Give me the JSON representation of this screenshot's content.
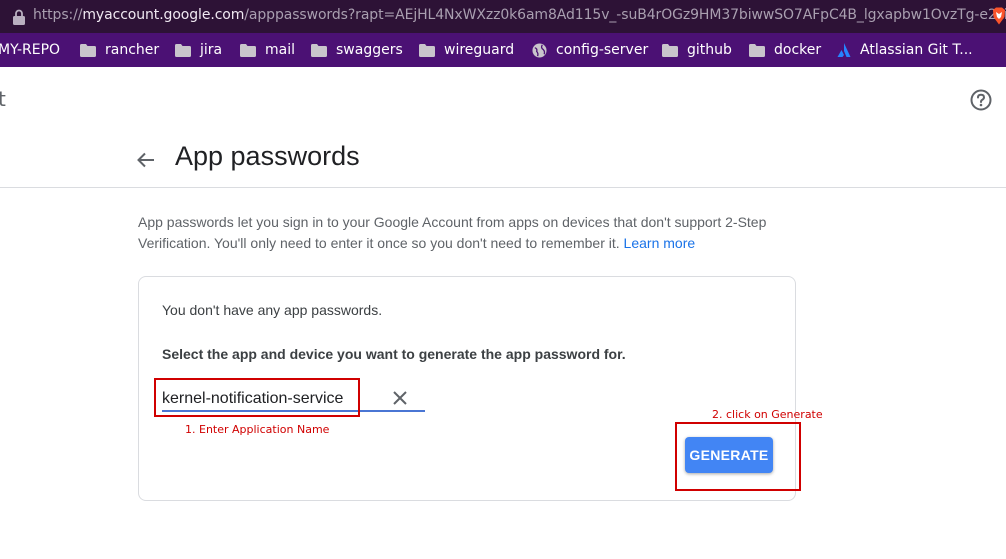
{
  "browser": {
    "url_prefix": "https://",
    "url_host": "myaccount.google.com",
    "url_rest": "/apppasswords?rapt=AEjHL4NxWXzz0k6am8Ad115v_-suB4rOGz9HM37biwwSO7AFpC4B_lgxapbw1OvzTg-e2zi4ileT...",
    "bookmarks": [
      {
        "label": "MY-REPO",
        "icon": "none"
      },
      {
        "label": "rancher",
        "icon": "folder-icon"
      },
      {
        "label": "jira",
        "icon": "folder-icon"
      },
      {
        "label": "mail",
        "icon": "folder-icon"
      },
      {
        "label": "swaggers",
        "icon": "folder-icon"
      },
      {
        "label": "wireguard",
        "icon": "folder-icon"
      },
      {
        "label": "config-server",
        "icon": "globe-icon"
      },
      {
        "label": "github",
        "icon": "folder-icon"
      },
      {
        "label": "docker",
        "icon": "folder-icon"
      },
      {
        "label": "Atlassian Git T...",
        "icon": "atlassian-icon"
      }
    ],
    "colors": {
      "address_bar": "#2d1236",
      "bookmark_bar": "#4b1174"
    }
  },
  "header": {
    "partial_title": "t"
  },
  "page": {
    "title": "App passwords",
    "description": "App passwords let you sign in to your Google Account from apps on devices that don't support 2-Step Verification. You'll only need to enter it once so you don't need to remember it.",
    "learn_more": "Learn more"
  },
  "card": {
    "no_passwords": "You don't have any app passwords.",
    "select_label": "Select the app and device you want to generate the app password for.",
    "app_name_value": "kernel-notification-service",
    "generate_label": "GENERATE"
  },
  "annotations": {
    "step1": "1. Enter Application Name",
    "step2": "2. click on Generate",
    "color": "#d00000"
  }
}
